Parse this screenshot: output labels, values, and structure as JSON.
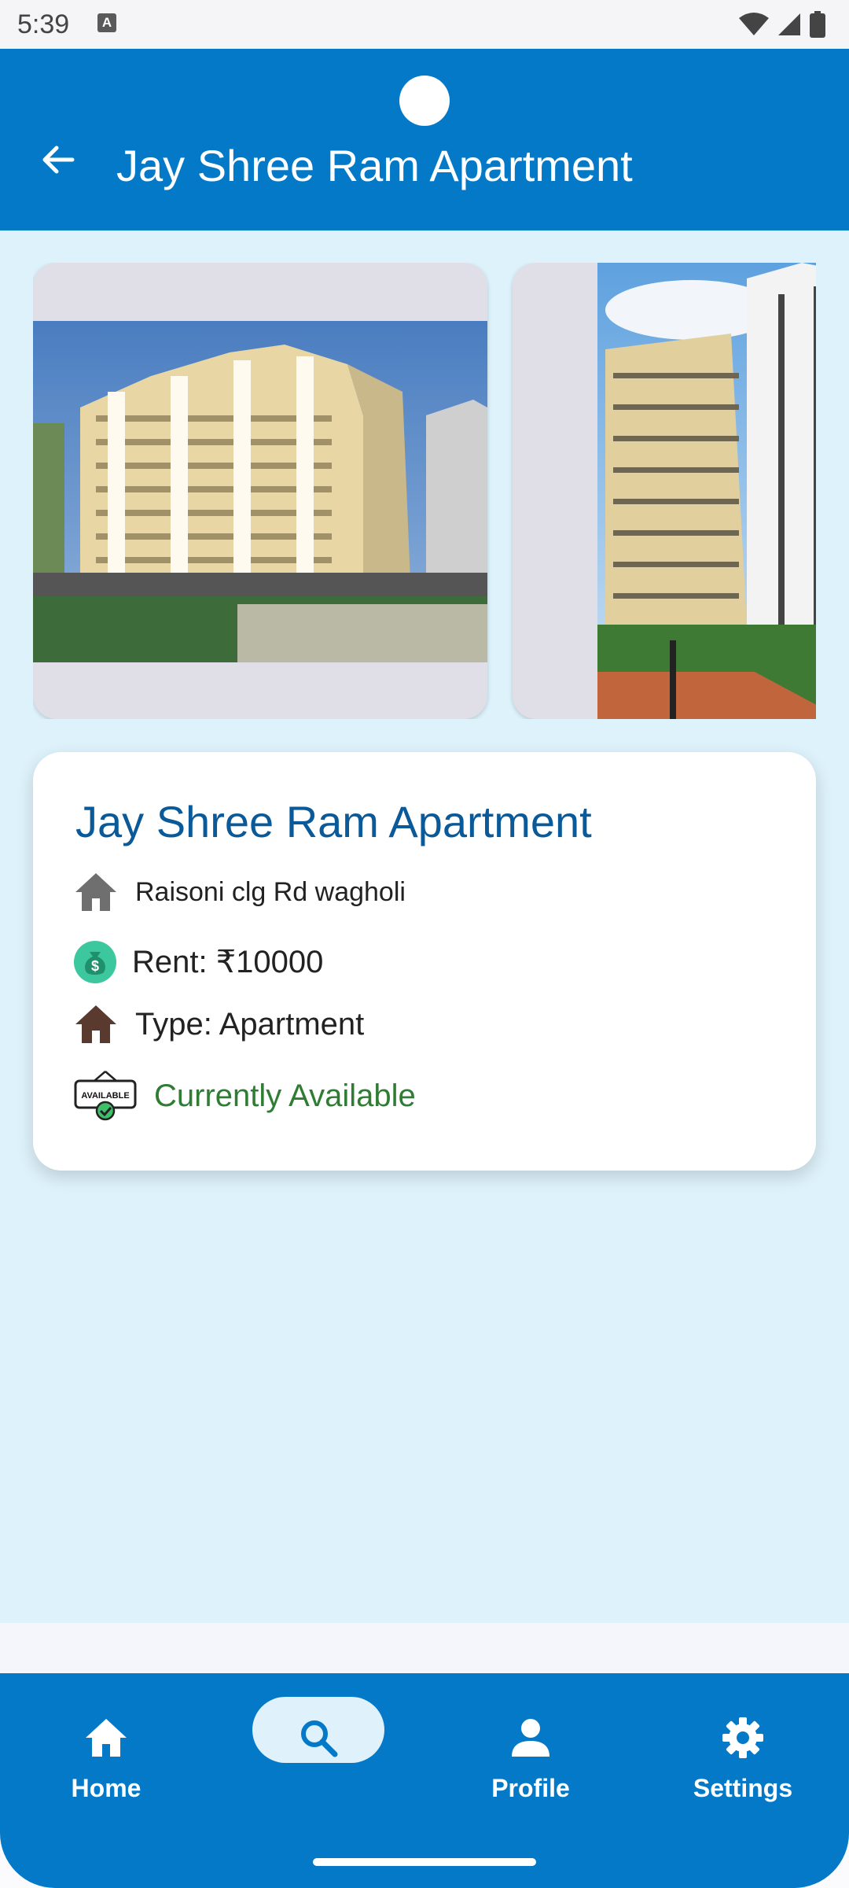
{
  "status_bar": {
    "time": "5:39",
    "notification_icon": "A"
  },
  "app_bar": {
    "title": "Jay Shree Ram Apartment",
    "back_icon": "arrow-left-icon"
  },
  "carousel": {
    "images": [
      "apartment-photo-1",
      "apartment-photo-2"
    ]
  },
  "property": {
    "name": "Jay Shree Ram Apartment",
    "address": "Raisoni clg Rd wagholi",
    "rent": "Rent: ₹10000",
    "type": "Type: Apartment",
    "availability": "Currently Available",
    "available_badge": "AVAILABLE"
  },
  "bottom_nav": {
    "items": [
      {
        "label": "Home",
        "icon": "home-icon"
      },
      {
        "label": "",
        "icon": "search-icon",
        "selected": true
      },
      {
        "label": "Profile",
        "icon": "person-icon"
      },
      {
        "label": "Settings",
        "icon": "gear-icon"
      }
    ]
  },
  "colors": {
    "primary": "#0379c8",
    "background": "#def2fb",
    "title": "#0a5a99",
    "available": "#2e7d32"
  }
}
